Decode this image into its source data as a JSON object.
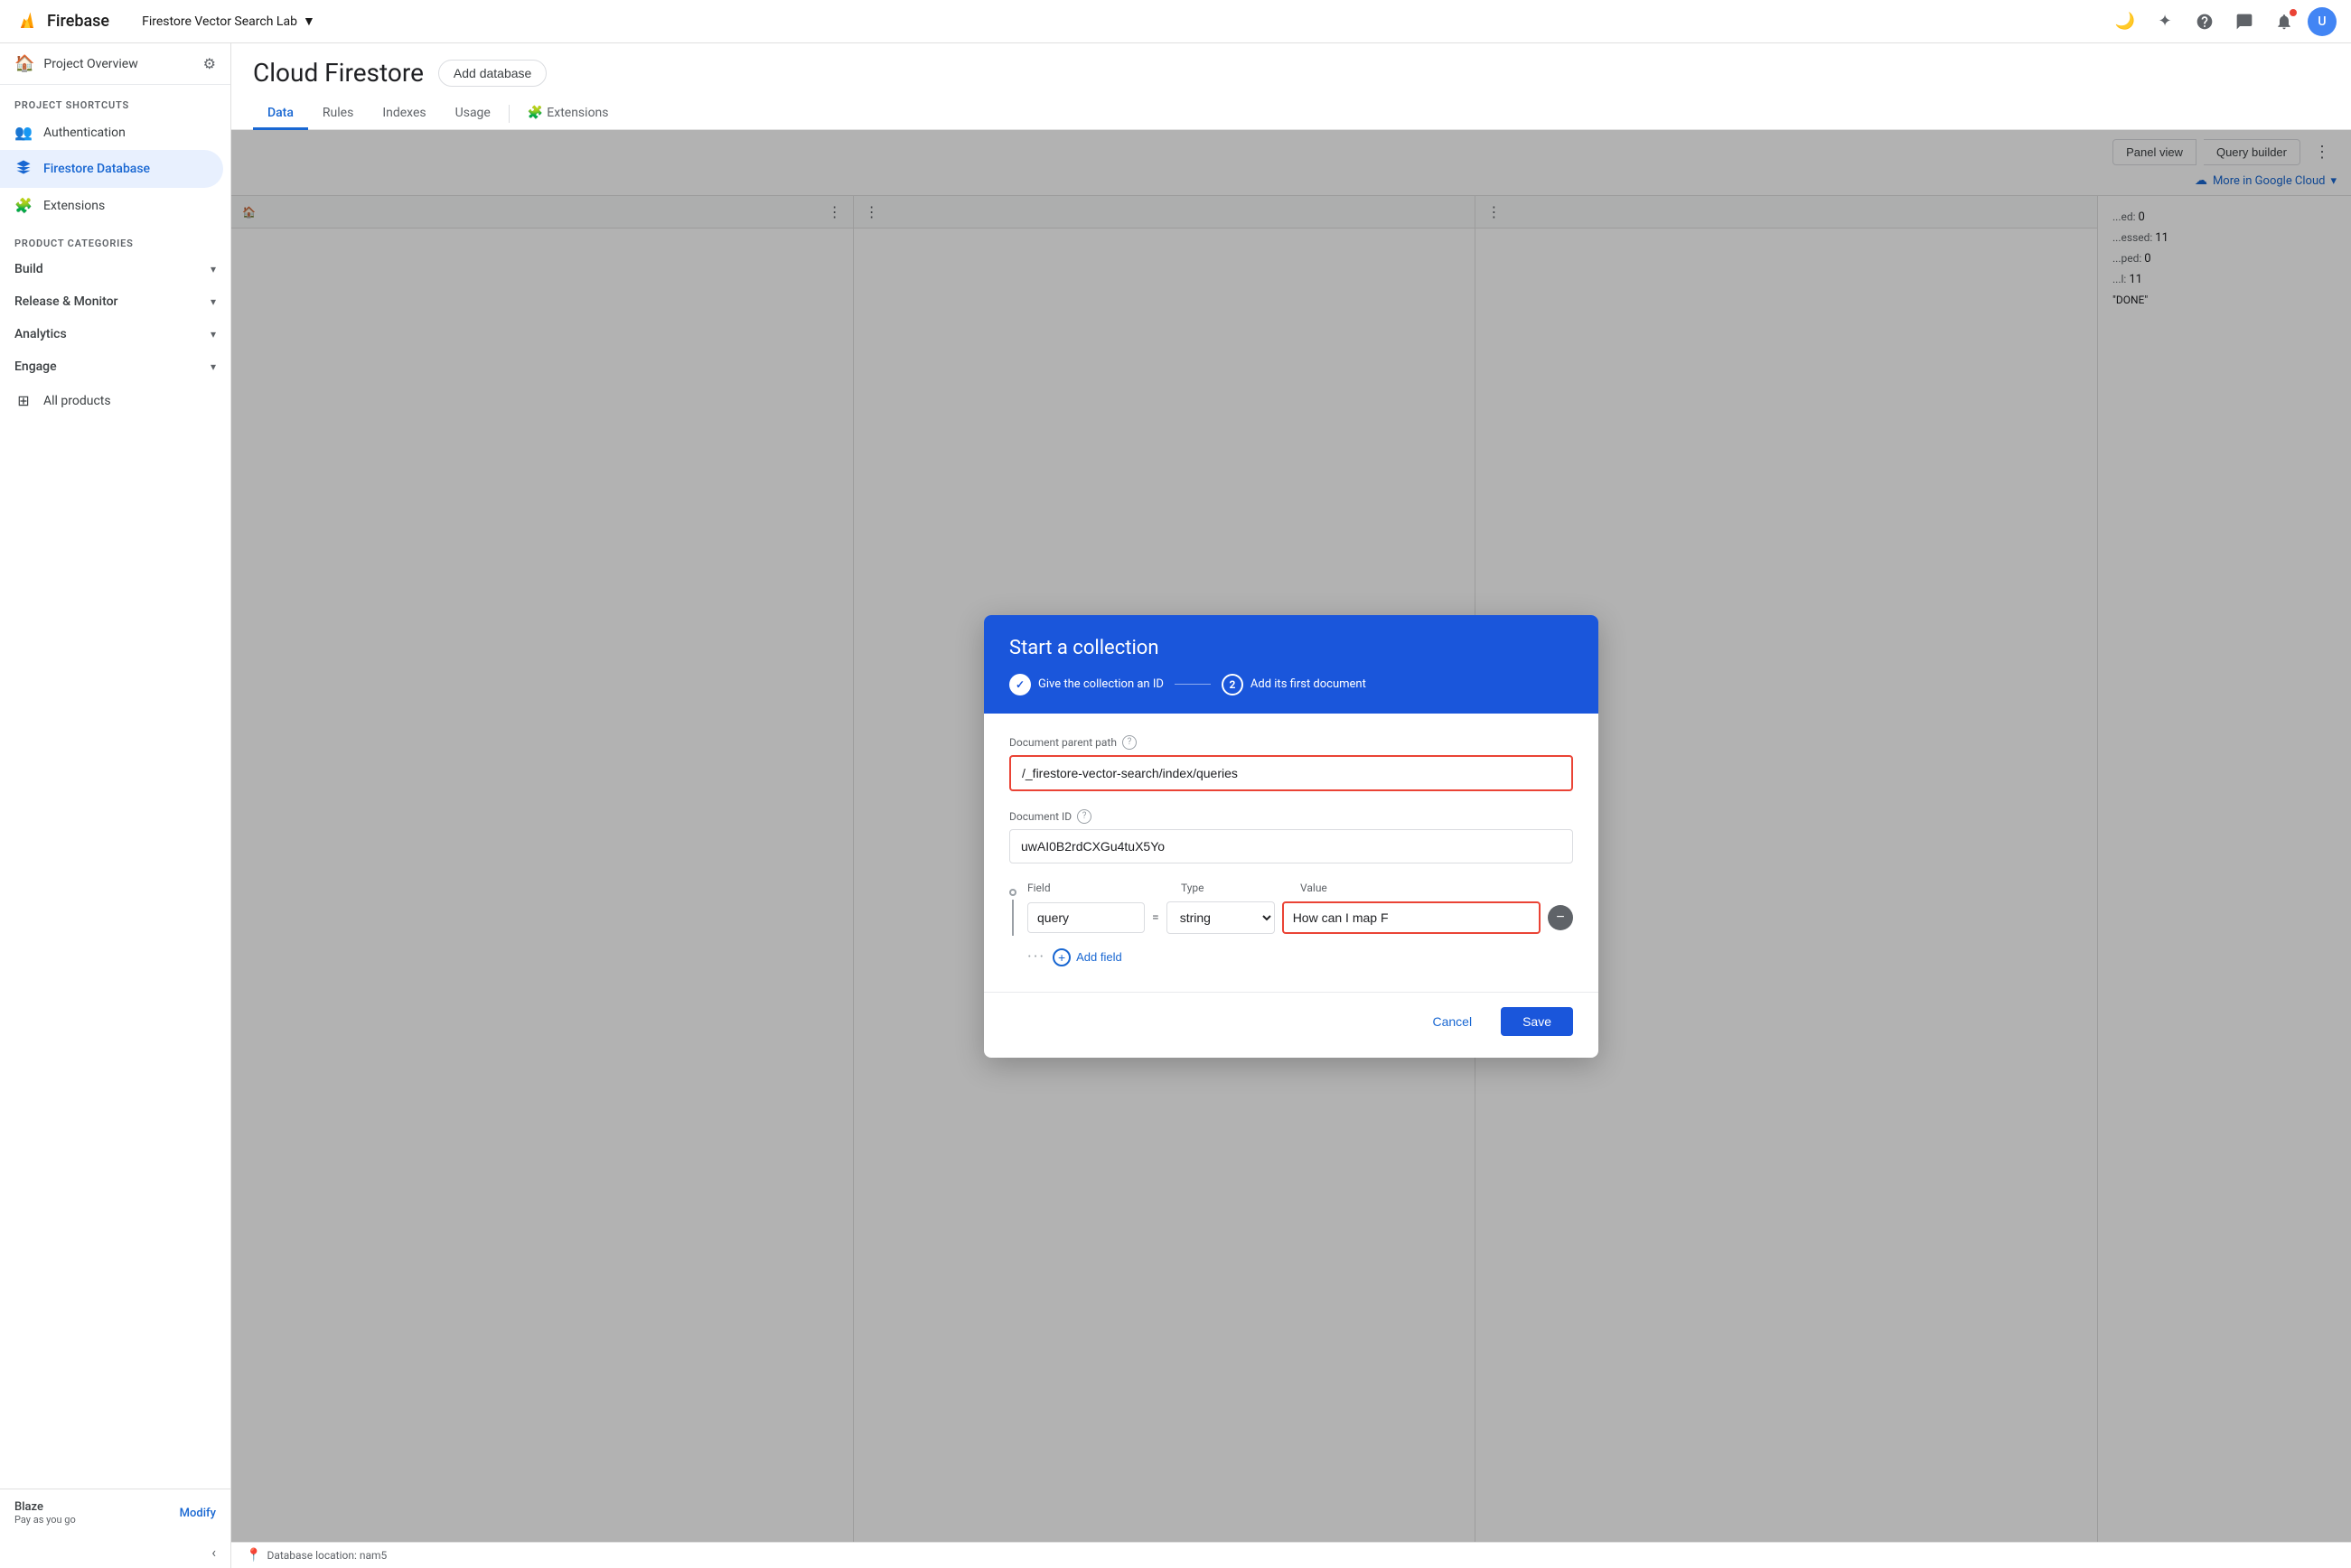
{
  "header": {
    "firebase_label": "Firebase",
    "project_name": "Firestore Vector Search Lab",
    "chevron": "▼",
    "icons": {
      "dark_mode": "🌙",
      "star": "✦",
      "help": "?",
      "chat": "💬",
      "bell": "🔔",
      "avatar_initial": "U"
    }
  },
  "sidebar": {
    "project_overview": "Project Overview",
    "settings_icon": "⚙",
    "sections": {
      "project_shortcuts_label": "Project shortcuts",
      "authentication_label": "Authentication",
      "firestore_database_label": "Firestore Database",
      "extensions_label": "Extensions",
      "product_categories_label": "Product categories",
      "build_label": "Build",
      "release_monitor_label": "Release & Monitor",
      "analytics_label": "Analytics",
      "engage_label": "Engage",
      "all_products_label": "All products"
    },
    "blaze": {
      "title": "Blaze",
      "subtitle": "Pay as you go",
      "modify": "Modify"
    },
    "collapse_icon": "‹"
  },
  "firestore": {
    "title": "Cloud Firestore",
    "add_database_btn": "Add database",
    "tabs": {
      "data": "Data",
      "rules": "Rules",
      "indexes": "Indexes",
      "usage": "Usage",
      "extensions": "Extensions"
    },
    "panel_view_btn": "Panel view",
    "query_builder_btn": "Query builder",
    "more_google_cloud": "More in Google Cloud"
  },
  "dialog": {
    "title": "Start a collection",
    "steps": {
      "step1_label": "Give the collection an ID",
      "step2_number": "2",
      "step2_label": "Add its first document"
    },
    "document_parent_path_label": "Document parent path",
    "document_parent_path_value": "/_firestore-vector-search/index/queries",
    "document_id_label": "Document ID",
    "document_id_value": "uwAI0B2rdCXGu4tuX5Yo",
    "fields": {
      "column_field": "Field",
      "column_type": "Type",
      "column_value": "Value",
      "field_name": "query",
      "field_type": "string",
      "field_value": "How can I map F"
    },
    "add_field_label": "Add field",
    "cancel_btn": "Cancel",
    "save_btn": "Save"
  },
  "stats": {
    "indexed": "0",
    "processed": "11",
    "skipped": "0",
    "total": "11",
    "status": "\"DONE\""
  },
  "bottom_bar": {
    "location_label": "Database location: nam5"
  }
}
